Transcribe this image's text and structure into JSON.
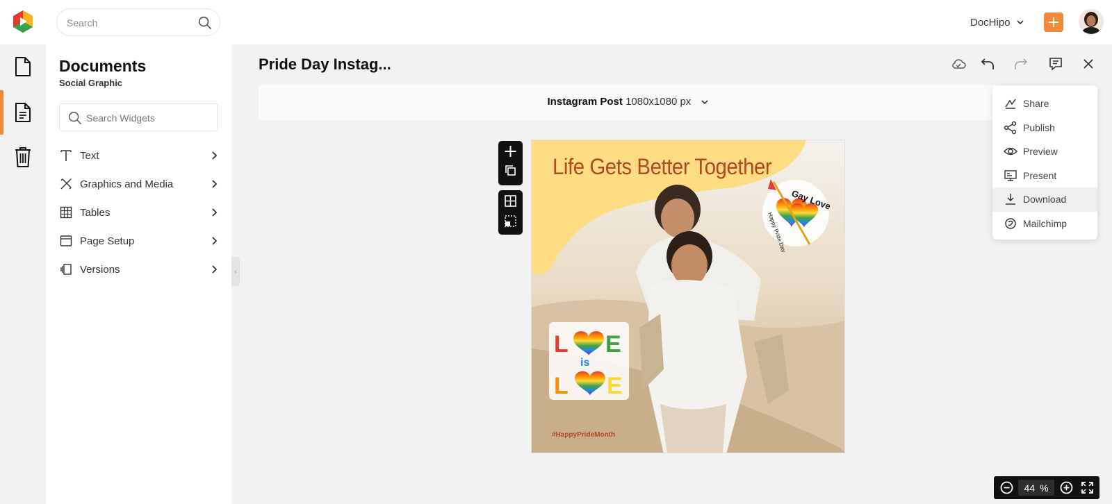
{
  "app": {
    "account_name": "DocHipo"
  },
  "search": {
    "placeholder": "Search"
  },
  "panel": {
    "title": "Documents",
    "subtitle": "Social Graphic",
    "widget_search_placeholder": "Search Widgets",
    "menu": [
      {
        "label": "Text",
        "icon": "text-icon"
      },
      {
        "label": "Graphics and Media",
        "icon": "graphics-icon"
      },
      {
        "label": "Tables",
        "icon": "table-icon"
      },
      {
        "label": "Page Setup",
        "icon": "page-setup-icon"
      },
      {
        "label": "Versions",
        "icon": "versions-icon"
      }
    ]
  },
  "document": {
    "title": "Pride Day Instag...",
    "size_name": "Instagram Post",
    "size_dims": "1080x1080 px"
  },
  "canvas": {
    "headline": "Life Gets Better Together",
    "hashtag": "#HappyPrideMonth",
    "sticker_left": "LOVE is LOVE",
    "sticker_right_top": "Gay Love",
    "sticker_right_sub": "Happy Pride Day"
  },
  "dropdown": {
    "items": [
      {
        "label": "Share",
        "icon": "share-icon"
      },
      {
        "label": "Publish",
        "icon": "publish-icon"
      },
      {
        "label": "Preview",
        "icon": "eye-icon"
      },
      {
        "label": "Present",
        "icon": "present-icon"
      },
      {
        "label": "Download",
        "icon": "download-icon",
        "highlighted": true
      },
      {
        "label": "Mailchimp",
        "icon": "mailchimp-icon"
      }
    ]
  },
  "zoom": {
    "value": "44",
    "unit": "%"
  },
  "colors": {
    "accent": "#f38a39",
    "headline": "#b24a21",
    "blob": "#fddc84"
  }
}
